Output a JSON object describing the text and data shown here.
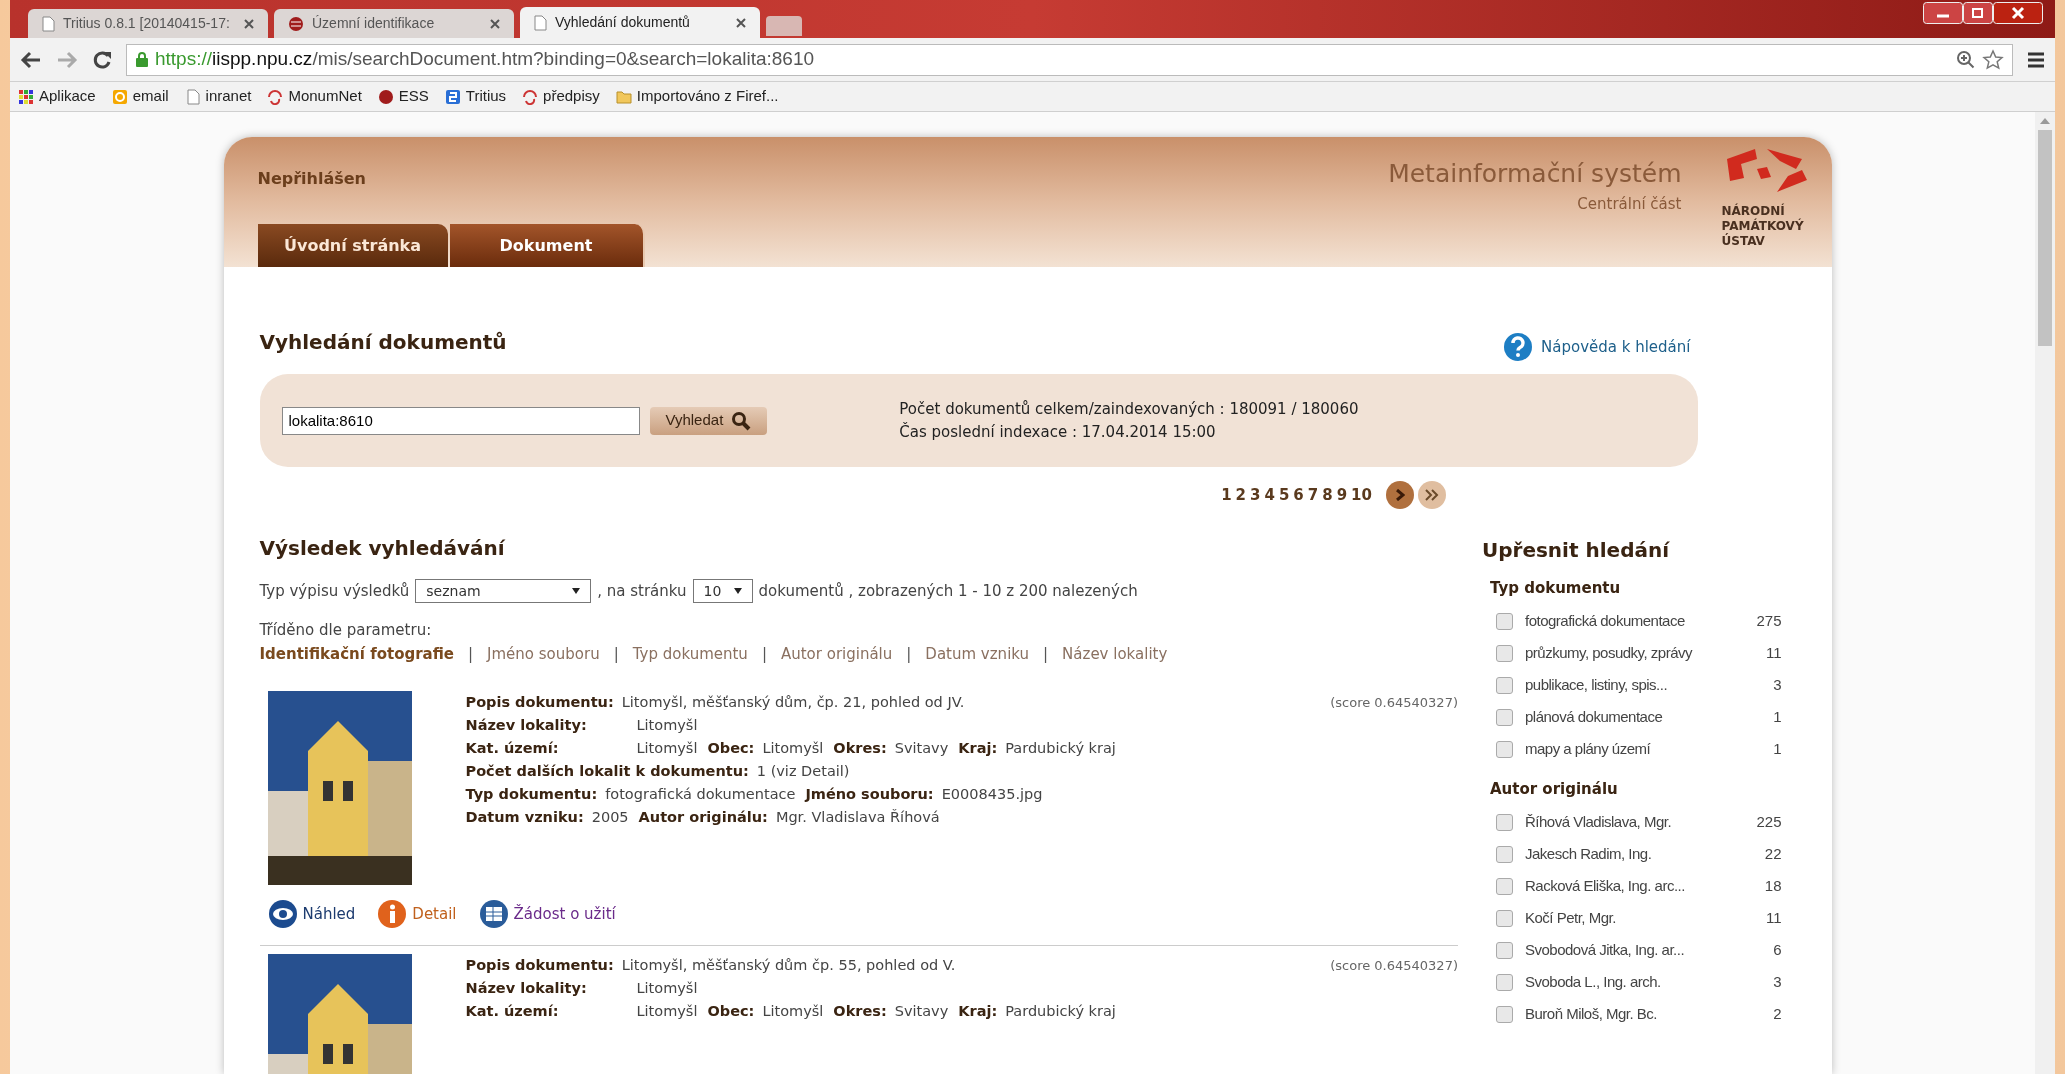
{
  "browser": {
    "tabs": [
      {
        "title": "Tritius 0.8.1 [20140415-17:",
        "selected": false,
        "kind": "page"
      },
      {
        "title": "Územní identifikace",
        "selected": false,
        "kind": "site"
      },
      {
        "title": "Vyhledání dokumentů",
        "selected": true,
        "kind": "page"
      }
    ],
    "address": {
      "scheme": "https://",
      "host": "iispp.npu.cz",
      "path": "/mis/searchDocument.htm?binding=0&search=lokalita:8610"
    },
    "bookmarks": [
      {
        "label": "Aplikace",
        "kind": "apps"
      },
      {
        "label": "email",
        "kind": "mail"
      },
      {
        "label": "inranet",
        "kind": "page"
      },
      {
        "label": "MonumNet",
        "kind": "swirl"
      },
      {
        "label": "ESS",
        "kind": "ball"
      },
      {
        "label": "Tritius",
        "kind": "square"
      },
      {
        "label": "předpisy",
        "kind": "swirl"
      },
      {
        "label": "Importováno z Firef...",
        "kind": "folder"
      }
    ]
  },
  "header": {
    "login_status": "Nepřihlášen",
    "system_title": "Metainformační systém",
    "system_subtitle": "Centrální část",
    "logo_text": [
      "NÁRODNÍ",
      "PAMÁTKOVÝ",
      "ÚSTAV"
    ],
    "nav_tabs": [
      {
        "label": "Úvodní stránka",
        "selected": false
      },
      {
        "label": "Dokument",
        "selected": true
      }
    ]
  },
  "search": {
    "title": "Vyhledání dokumentů",
    "help_link": "Nápověda k hledání",
    "query": "lokalita:8610",
    "button": "Vyhledat",
    "stats": [
      "Počet dokumentů celkem/zaindexovaných : 180091 / 180060",
      "Čas poslední indexace : 17.04.2014 15:00"
    ]
  },
  "pagination": {
    "pages": [
      "1",
      "2",
      "3",
      "4",
      "5",
      "6",
      "7",
      "8",
      "9",
      "10"
    ]
  },
  "results": {
    "title": "Výsledek vyhledávání",
    "listing_label": "Typ výpisu výsledků",
    "listing_value": "seznam",
    "per_page_label": ", na stránku",
    "per_page_value": "10",
    "summary": "dokumentů , zobrazených 1 - 10 z 200 nalezených",
    "sort_label": "Tříděno dle parametru:",
    "sort_options": [
      {
        "label": "Identifikační fotografie",
        "selected": true
      },
      {
        "separator": "|",
        "label": "Jméno souboru",
        "selected": false
      },
      {
        "separator": "|",
        "label": "Typ dokumentu",
        "selected": false
      },
      {
        "separator": "|",
        "label": "Autor originálu",
        "selected": false
      },
      {
        "separator": "|",
        "label": "Datum vzniku",
        "selected": false
      },
      {
        "separator": "|",
        "label": "Název lokality",
        "selected": false
      }
    ],
    "items": [
      {
        "score": "(score 0.64540327)",
        "lines": [
          {
            "kind": "inline",
            "parts": [
              {
                "label": "Popis dokumentu:",
                "value": "Litomyšl, měšťanský dům, čp. 21, pohled od JV."
              }
            ]
          },
          {
            "kind": "aligned",
            "parts": [
              {
                "label": "Název lokality:",
                "value": "Litomyšl"
              }
            ]
          },
          {
            "kind": "aligned",
            "parts": [
              {
                "label": "Kat. území:",
                "value": "Litomyšl"
              },
              {
                "label": "Obec:",
                "value": "Litomyšl"
              },
              {
                "label": "Okres:",
                "value": "Svitavy"
              },
              {
                "label": "Kraj:",
                "value": "Pardubický kraj"
              }
            ]
          },
          {
            "kind": "inline",
            "parts": [
              {
                "label": "Počet dalších lokalit k dokumentu:",
                "value": "1  (viz Detail)"
              }
            ]
          },
          {
            "kind": "inline",
            "parts": [
              {
                "label": "Typ dokumentu:",
                "value": "fotografická dokumentace"
              },
              {
                "label": "Jméno souboru:",
                "value": "E0008435.jpg"
              }
            ]
          },
          {
            "kind": "inline",
            "parts": [
              {
                "label": "Datum vzniku:",
                "value": "2005"
              },
              {
                "label": "Autor originálu:",
                "value": "Mgr. Vladislava Říhová"
              }
            ]
          }
        ],
        "actions": [
          {
            "label": "Náhled",
            "kind": "eye"
          },
          {
            "label": "Detail",
            "kind": "info"
          },
          {
            "label": "Žádost o užití",
            "kind": "request"
          }
        ]
      },
      {
        "score": "(score 0.64540327)",
        "lines": [
          {
            "kind": "inline",
            "parts": [
              {
                "label": "Popis dokumentu:",
                "value": "Litomyšl, měšťanský dům čp. 55, pohled od V."
              }
            ]
          },
          {
            "kind": "aligned",
            "parts": [
              {
                "label": "Název lokality:",
                "value": "Litomyšl"
              }
            ]
          },
          {
            "kind": "aligned",
            "parts": [
              {
                "label": "Kat. území:",
                "value": "Litomyšl"
              },
              {
                "label": "Obec:",
                "value": "Litomyšl"
              },
              {
                "label": "Okres:",
                "value": "Svitavy"
              },
              {
                "label": "Kraj:",
                "value": "Pardubický kraj"
              }
            ]
          }
        ]
      }
    ]
  },
  "refine": {
    "title": "Upřesnit hledání",
    "groups": [
      {
        "title": "Typ dokumentu",
        "options": [
          {
            "label": "fotografická dokumentace",
            "count": "275",
            "checked": false
          },
          {
            "label": "průzkumy, posudky, zprávy",
            "count": "11",
            "checked": false
          },
          {
            "label": "publikace, listiny, spis...",
            "count": "3",
            "checked": false
          },
          {
            "label": "plánová dokumentace",
            "count": "1",
            "checked": false
          },
          {
            "label": "mapy a plány území",
            "count": "1",
            "checked": false
          }
        ]
      },
      {
        "title": "Autor originálu",
        "options": [
          {
            "label": "Říhová Vladislava, Mgr.",
            "count": "225",
            "checked": false
          },
          {
            "label": "Jakesch Radim, Ing.",
            "count": "22",
            "checked": false
          },
          {
            "label": "Racková Eliška, Ing. arc...",
            "count": "18",
            "checked": false
          },
          {
            "label": "Kočí Petr, Mgr.",
            "count": "11",
            "checked": false
          },
          {
            "label": "Svobodová Jitka, Ing. ar...",
            "count": "6",
            "checked": false
          },
          {
            "label": "Svoboda L., Ing. arch.",
            "count": "3",
            "checked": false
          },
          {
            "label": "Buroň Miloš, Mgr. Bc.",
            "count": "2",
            "checked": false
          }
        ]
      }
    ]
  }
}
